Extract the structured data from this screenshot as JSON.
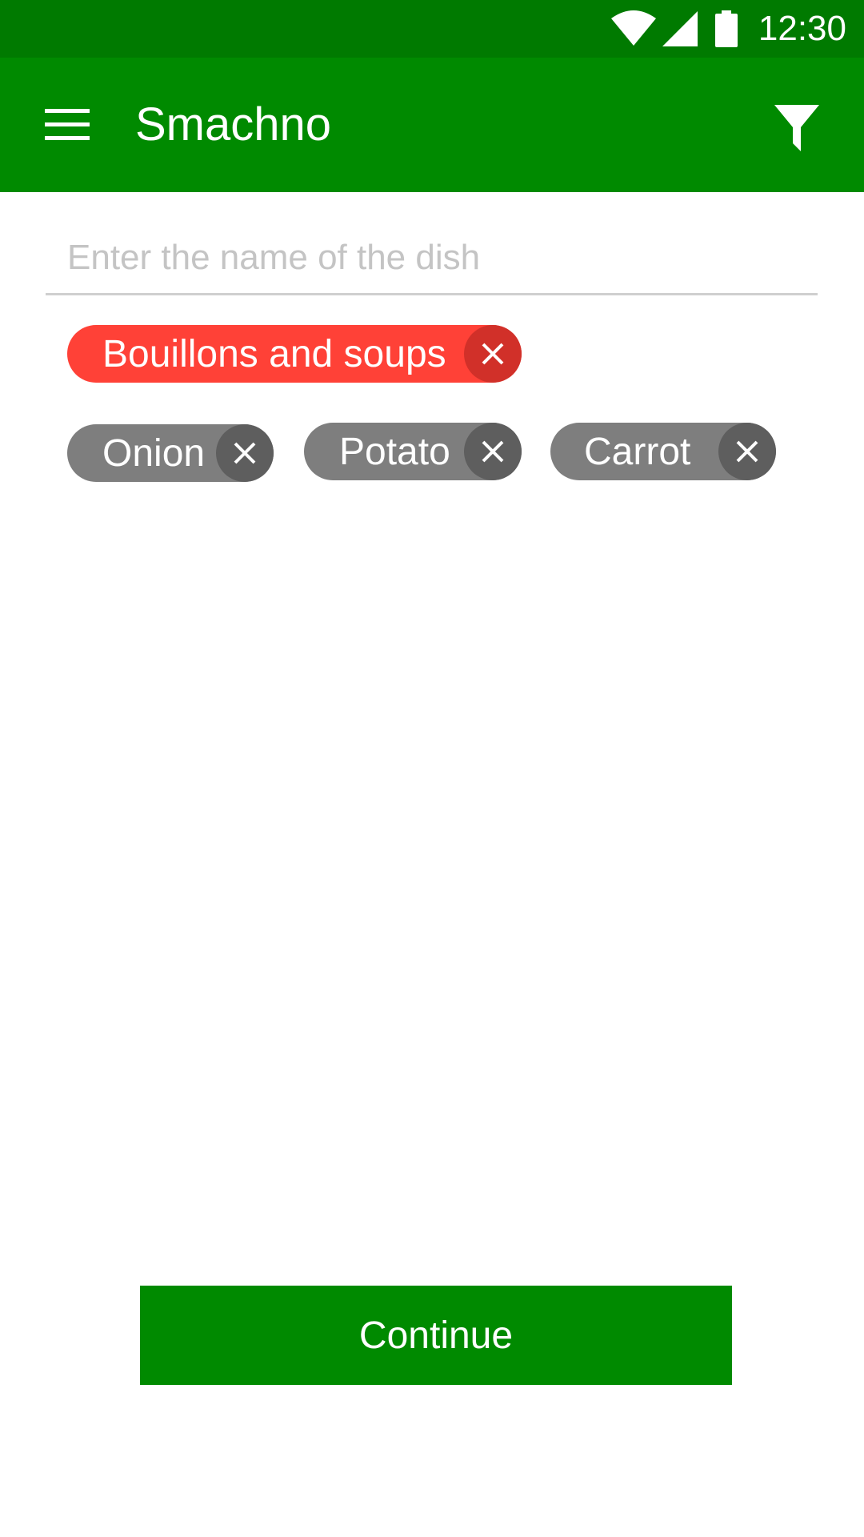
{
  "status_bar": {
    "time": "12:30",
    "icons": [
      "wifi-icon",
      "cell-signal-icon",
      "battery-icon"
    ]
  },
  "app_bar": {
    "title": "Smachno",
    "left_icon": "menu-icon",
    "right_icon": "filter-icon"
  },
  "search": {
    "placeholder": "Enter the name of the dish",
    "value": ""
  },
  "category_chips": [
    {
      "label": "Bouillons and soups",
      "color": "#ff4137"
    }
  ],
  "ingredient_chips": [
    {
      "label": "Onion",
      "color": "#7e7e7e"
    },
    {
      "label": "Potato",
      "color": "#7e7e7e"
    },
    {
      "label": "Carrot",
      "color": "#7e7e7e"
    }
  ],
  "actions": {
    "continue_label": "Continue"
  },
  "colors": {
    "status_bar": "#007a00",
    "app_bar": "#008a00",
    "primary_button": "#008a00",
    "category_chip": "#ff4137",
    "ingredient_chip": "#7e7e7e"
  }
}
